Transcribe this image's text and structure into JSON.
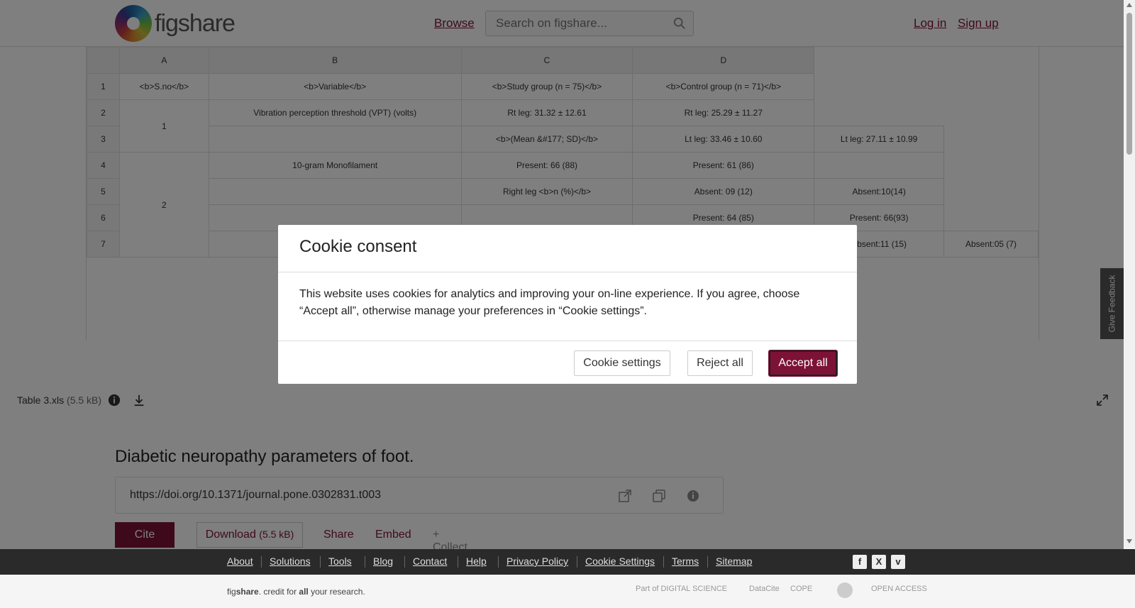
{
  "header": {
    "logo_text": "figshare",
    "browse": "Browse",
    "search_placeholder": "Search on figshare...",
    "login": "Log in",
    "signup": "Sign up"
  },
  "sheet": {
    "columns": [
      "",
      "A",
      "B",
      "C",
      "D"
    ],
    "rows": [
      [
        "1",
        "<b>S.no</b>",
        "<b>Variable</b>",
        "<b>Study group (n = 75)</b>",
        "<b>Control group (n = 71)</b>"
      ],
      [
        "2",
        "1",
        "Vibration perception threshold (VPT) (volts)",
        "Rt leg: 31.32 ± 12.61",
        "Rt leg: 25.29 ± 11.27"
      ],
      [
        "3",
        "",
        "",
        "<b>(Mean &#177; SD)</b>",
        "Lt leg: 33.46 ± 10.60",
        "Lt leg: 27.11 ± 10.99"
      ],
      [
        "4",
        "2",
        "10-gram Monofilament",
        "Present: 66 (88)",
        "Present: 61 (86)"
      ],
      [
        "5",
        "",
        "",
        "Right leg <b>n (%)</b>",
        "Absent: 09 (12)",
        "Absent:10(14)"
      ],
      [
        "6",
        "",
        "",
        "",
        "Present: 64 (85)",
        "Present: 66(93)"
      ],
      [
        "7",
        "",
        "",
        "",
        "",
        "Absent:11 (15)",
        "Absent:05 (7)"
      ]
    ]
  },
  "filebar": {
    "filename": "Table 3.xls",
    "size": "(5.5 kB)"
  },
  "item": {
    "title": "Diabetic neuropathy parameters of foot.",
    "doi": "https://doi.org/10.1371/journal.pone.0302831.t003",
    "cite": "Cite",
    "download": "Download",
    "download_size": "(5.5 kB)",
    "share": "Share",
    "embed": "Embed",
    "collect": "+ Collect"
  },
  "feedback": "Give Feedback",
  "modal": {
    "title": "Cookie consent",
    "body": "This website uses cookies for analytics and improving your on-line experience. If you agree, choose “Accept all”, otherwise manage your preferences in “Cookie settings”.",
    "settings": "Cookie settings",
    "reject": "Reject all",
    "accept": "Accept all"
  },
  "footer": {
    "links": [
      "About",
      "Solutions",
      "Tools",
      "Blog",
      "Contact",
      "Help",
      "Privacy Policy",
      "Cookie Settings",
      "Terms",
      "Sitemap"
    ],
    "social": [
      "f",
      "X",
      "v"
    ],
    "tagline_pre": "fig",
    "tagline_brand": "share",
    "tagline_mid": ". credit for ",
    "tagline_all": "all",
    "tagline_post": " your research.",
    "partners": [
      "Part of DIGITAL SCIENCE",
      "DataCite",
      "COPE",
      "",
      "OPEN ACCESS"
    ]
  },
  "colors": {
    "brand": "#7c1236",
    "footer_bg": "#2a2a2a"
  }
}
